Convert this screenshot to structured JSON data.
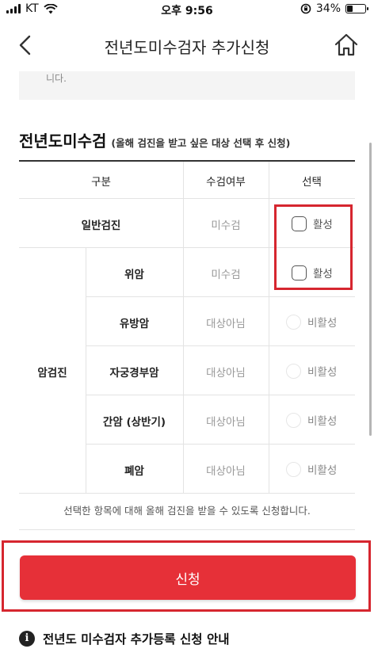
{
  "status_bar": {
    "carrier": "KT",
    "time": "오후 9:56",
    "battery": "34%",
    "battery_level": 0.34
  },
  "header": {
    "title": "전년도미수검자 추가신청"
  },
  "notice_fragment": "니다.",
  "section": {
    "title": "전년도미수검",
    "subtitle": "(올해 검진을 받고 싶은 대상 선택 후 신청)"
  },
  "table": {
    "headers": {
      "category": "구분",
      "status": "수검여부",
      "select": "선택"
    },
    "group_label": "암검진",
    "rows": [
      {
        "name": "일반검진",
        "status": "미수검",
        "option": "활성",
        "enabled": true
      },
      {
        "name": "위암",
        "status": "미수검",
        "option": "활성",
        "enabled": true
      },
      {
        "name": "유방암",
        "status": "대상아님",
        "option": "비활성",
        "enabled": false
      },
      {
        "name": "자궁경부암",
        "status": "대상아님",
        "option": "비활성",
        "enabled": false
      },
      {
        "name": "간암 (상반기)",
        "status": "대상아님",
        "option": "비활성",
        "enabled": false
      },
      {
        "name": "폐암",
        "status": "대상아님",
        "option": "비활성",
        "enabled": false
      }
    ]
  },
  "footnote": "선택한 항목에 대해 올해 검진을 받을 수 있도록 신청합니다.",
  "submit_label": "신청",
  "guide_title": "전년도 미수검자 추가등록 신청 안내",
  "colors": {
    "accent": "#e63038",
    "highlight": "#d6262f"
  }
}
